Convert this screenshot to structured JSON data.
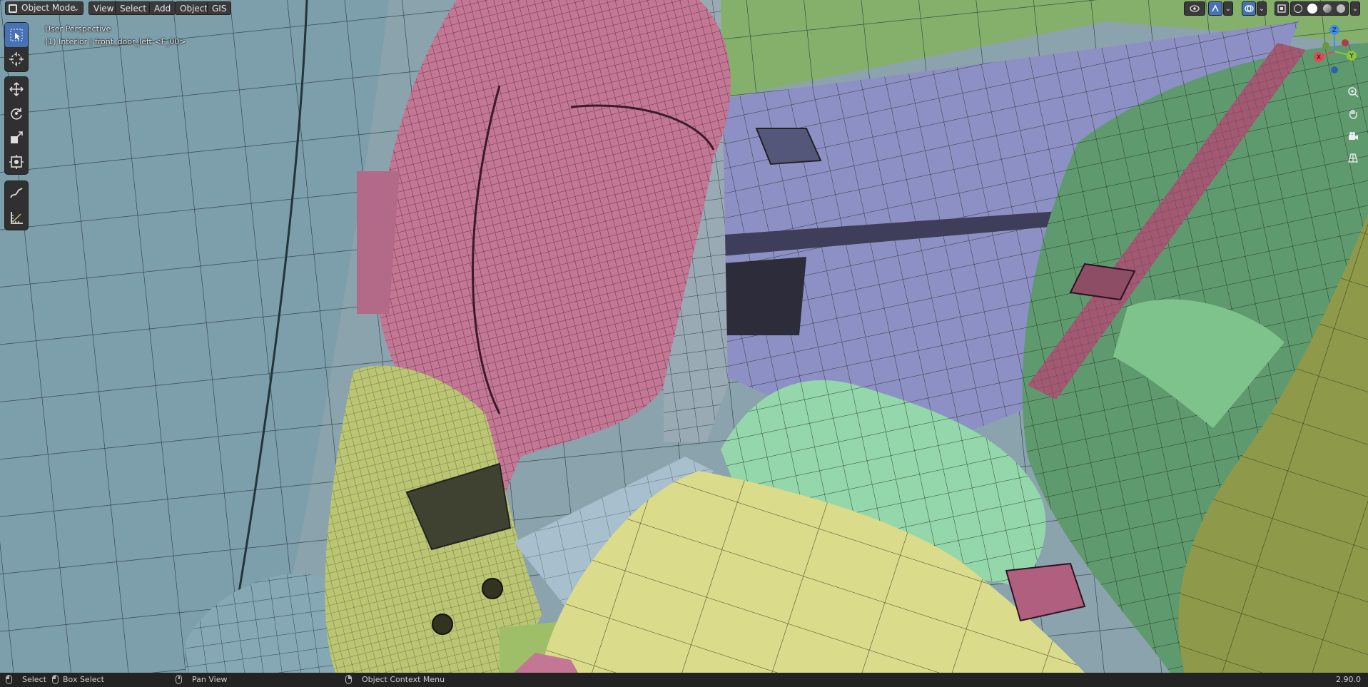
{
  "header": {
    "mode_label": "Object Mode",
    "menus": [
      "View",
      "Select",
      "Add",
      "Object",
      "GIS"
    ]
  },
  "overlay": {
    "view_name": "User Perspective",
    "object_info": "(1) Interior | front_door_left <F_00>"
  },
  "toolbar": {
    "group1": [
      "select-box-icon",
      "cursor-icon"
    ],
    "group2": [
      "move-icon",
      "rotate-icon",
      "scale-icon",
      "transform-icon"
    ],
    "group3": [
      "annotate-icon",
      "measure-icon"
    ]
  },
  "gizmo": {
    "axes": [
      "X",
      "Y",
      "Z"
    ],
    "colors": {
      "x": "#e5475a",
      "y": "#8bc43f",
      "z": "#3f8ee8"
    }
  },
  "statusbar": {
    "select": "Select",
    "box_select": "Box Select",
    "pan_view": "Pan View",
    "context_menu": "Object Context Menu",
    "version": "2.90.0"
  },
  "colors": {
    "seat_blue": "#7d9eab",
    "seat_pink": "#c27592",
    "door_purple": "#8c8fc2",
    "console_yellow_green": "#b9c571",
    "cushion_yellow": "#d9da8a",
    "cushion_mint": "#92d6a9",
    "seat_green": "#5f9a6e",
    "accent": "#4772b3"
  }
}
